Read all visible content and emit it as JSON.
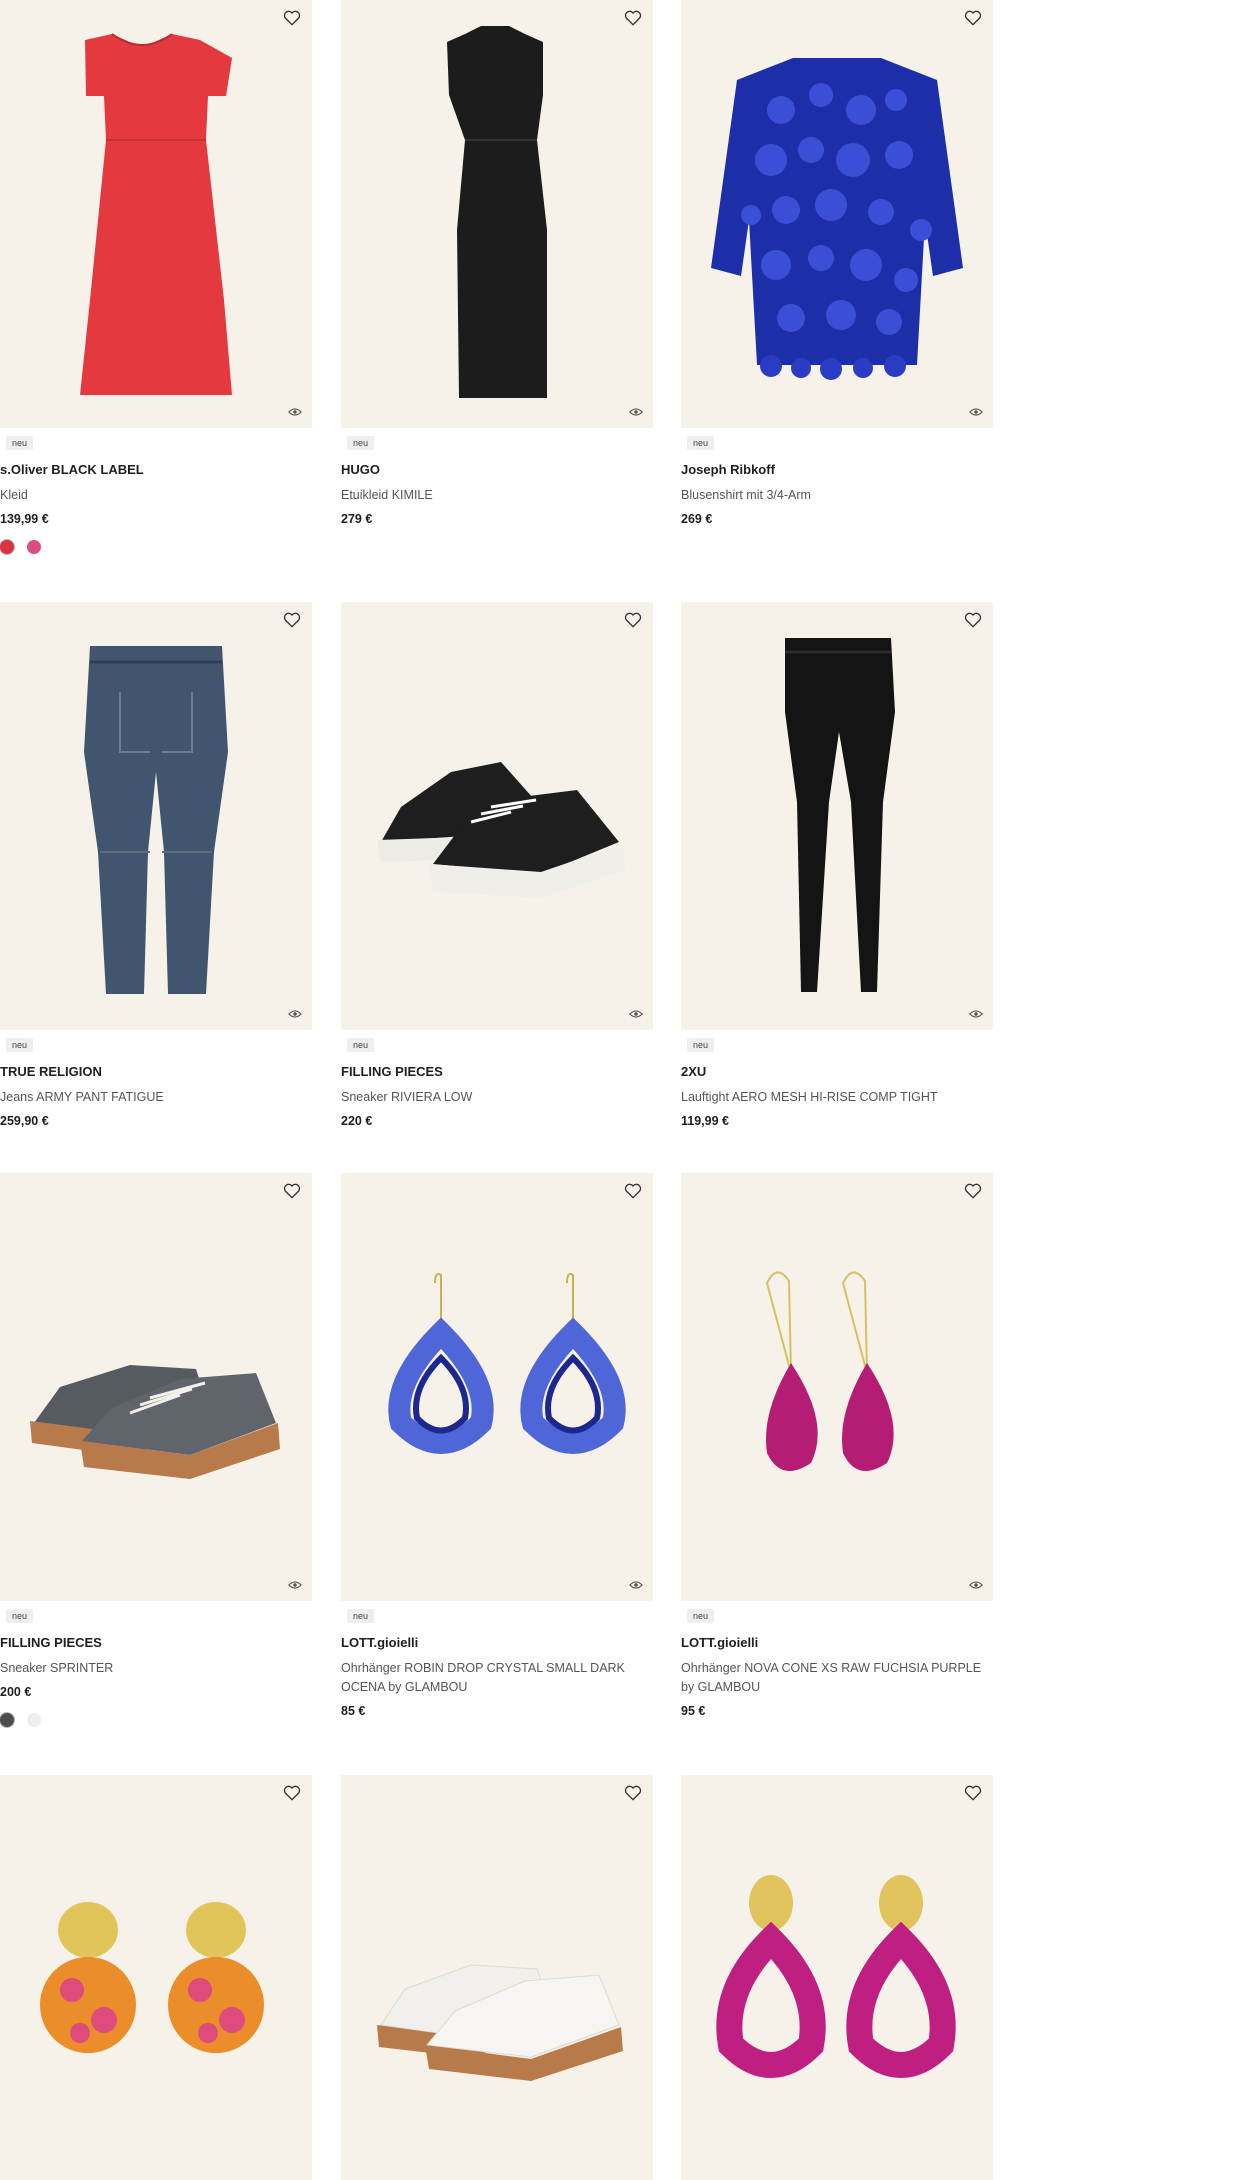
{
  "products": [
    {
      "badge": "neu",
      "brand": "s.Oliver BLACK LABEL",
      "name": "Kleid",
      "price": "139,99 €",
      "swatches": [
        "#d8343d",
        "#d94f83"
      ]
    },
    {
      "badge": "neu",
      "brand": "HUGO",
      "name": "Etuikleid KIMILE",
      "price": "279 €",
      "swatches": []
    },
    {
      "badge": "neu",
      "brand": "Joseph Ribkoff",
      "name": "Blusenshirt mit 3/4-Arm",
      "price": "269 €",
      "swatches": []
    },
    {
      "badge": "neu",
      "brand": "TRUE RELIGION",
      "name": "Jeans ARMY PANT FATIGUE",
      "price": "259,90 €",
      "swatches": []
    },
    {
      "badge": "neu",
      "brand": "FILLING PIECES",
      "name": "Sneaker RIVIERA LOW",
      "price": "220 €",
      "swatches": []
    },
    {
      "badge": "neu",
      "brand": "2XU",
      "name": "Lauftight AERO MESH HI-RISE COMP TIGHT",
      "price": "119,99 €",
      "swatches": []
    },
    {
      "badge": "neu",
      "brand": "FILLING PIECES",
      "name": "Sneaker SPRINTER",
      "price": "200 €",
      "swatches": [
        "#4d4d4d",
        "#eeeeee"
      ]
    },
    {
      "badge": "neu",
      "brand": "LOTT.gioielli",
      "name": "Ohrhänger ROBIN DROP CRYSTAL SMALL DARK OCENA by GLAMBOU",
      "price": "85 €",
      "swatches": []
    },
    {
      "badge": "neu",
      "brand": "LOTT.gioielli",
      "name": "Ohrhänger NOVA CONE XS RAW FUCHSIA PURPLE by GLAMBOU",
      "price": "95 €",
      "swatches": []
    },
    {
      "badge": "",
      "brand": "",
      "name": "",
      "price": "",
      "swatches": []
    },
    {
      "badge": "",
      "brand": "",
      "name": "",
      "price": "",
      "swatches": []
    },
    {
      "badge": "",
      "brand": "",
      "name": "",
      "price": "",
      "swatches": []
    }
  ],
  "icons": {
    "favorite": "heart-outline-icon",
    "zoom": "view-icon"
  },
  "colors": {
    "image_bg": "#f6f2ea",
    "badge_bg": "#efefef",
    "text": "#1f1f1f",
    "muted": "#555555"
  }
}
